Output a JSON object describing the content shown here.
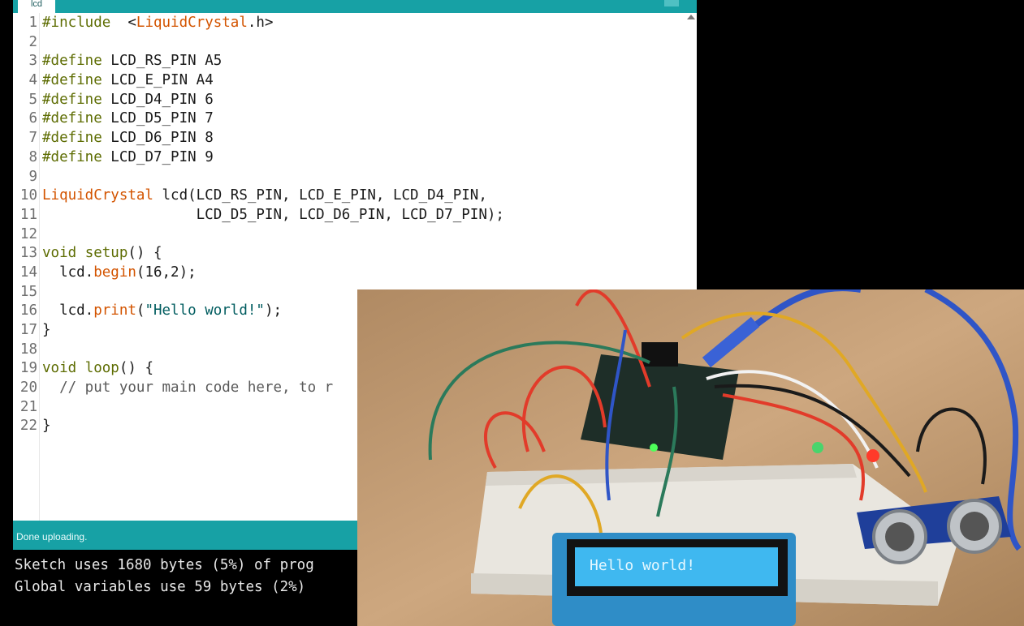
{
  "tab": {
    "label": "lcd"
  },
  "editor": {
    "lines": [
      {
        "n": "1",
        "parts": [
          [
            "kw",
            "#include"
          ],
          [
            "",
            "  <"
          ],
          [
            "cls",
            "LiquidCrystal"
          ],
          [
            "",
            ".h>"
          ]
        ]
      },
      {
        "n": "2",
        "parts": []
      },
      {
        "n": "3",
        "parts": [
          [
            "kw",
            "#define"
          ],
          [
            "",
            " LCD_RS_PIN A5"
          ]
        ]
      },
      {
        "n": "4",
        "parts": [
          [
            "kw",
            "#define"
          ],
          [
            "",
            " LCD_E_PIN A4"
          ]
        ]
      },
      {
        "n": "5",
        "parts": [
          [
            "kw",
            "#define"
          ],
          [
            "",
            " LCD_D4_PIN 6"
          ]
        ]
      },
      {
        "n": "6",
        "parts": [
          [
            "kw",
            "#define"
          ],
          [
            "",
            " LCD_D5_PIN 7"
          ]
        ]
      },
      {
        "n": "7",
        "parts": [
          [
            "kw",
            "#define"
          ],
          [
            "",
            " LCD_D6_PIN 8"
          ]
        ]
      },
      {
        "n": "8",
        "parts": [
          [
            "kw",
            "#define"
          ],
          [
            "",
            " LCD_D7_PIN 9"
          ]
        ]
      },
      {
        "n": "9",
        "parts": []
      },
      {
        "n": "10",
        "parts": [
          [
            "cls",
            "LiquidCrystal"
          ],
          [
            "",
            " lcd(LCD_RS_PIN, LCD_E_PIN, LCD_D4_PIN,"
          ]
        ]
      },
      {
        "n": "11",
        "parts": [
          [
            "",
            "                  LCD_D5_PIN, LCD_D6_PIN, LCD_D7_PIN);"
          ]
        ]
      },
      {
        "n": "12",
        "parts": []
      },
      {
        "n": "13",
        "parts": [
          [
            "kw",
            "void"
          ],
          [
            "",
            " "
          ],
          [
            "kw",
            "setup"
          ],
          [
            "",
            "() {"
          ]
        ]
      },
      {
        "n": "14",
        "parts": [
          [
            "",
            "  lcd."
          ],
          [
            "fn",
            "begin"
          ],
          [
            "",
            "(16,2);"
          ]
        ]
      },
      {
        "n": "15",
        "parts": []
      },
      {
        "n": "16",
        "parts": [
          [
            "",
            "  lcd."
          ],
          [
            "fn",
            "print"
          ],
          [
            "",
            "("
          ],
          [
            "str",
            "\"Hello world!\""
          ],
          [
            "",
            ");"
          ]
        ]
      },
      {
        "n": "17",
        "parts": [
          [
            "",
            "}"
          ]
        ]
      },
      {
        "n": "18",
        "parts": []
      },
      {
        "n": "19",
        "parts": [
          [
            "kw",
            "void"
          ],
          [
            "",
            " "
          ],
          [
            "kw",
            "loop"
          ],
          [
            "",
            "() {"
          ]
        ]
      },
      {
        "n": "20",
        "parts": [
          [
            "cm",
            "  // put your main code here, to r"
          ]
        ]
      },
      {
        "n": "21",
        "parts": []
      },
      {
        "n": "22",
        "parts": [
          [
            "",
            "}"
          ]
        ]
      }
    ]
  },
  "status": {
    "text": "Done uploading."
  },
  "console": {
    "lines": [
      "Sketch uses 1680 bytes (5%) of prog",
      "Global variables use 59 bytes (2%)"
    ]
  },
  "photo": {
    "lcd_text": "Hello world!",
    "colors": {
      "table": "#c9a77f",
      "lcd_screen": "#3fb8f0",
      "breadboard": "#e9e6df",
      "board": "#1e2e28"
    }
  }
}
